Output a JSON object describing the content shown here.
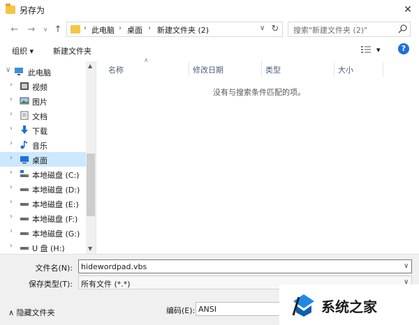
{
  "window": {
    "title": "另存为",
    "close_label": "✕"
  },
  "nav": {
    "back": "←",
    "forward": "→",
    "recent": "∨",
    "up": "↑",
    "breadcrumbs": [
      "此电脑",
      "桌面",
      "新建文件夹 (2)"
    ],
    "breadcrumb_sep": "›",
    "dropdown": "∨",
    "refresh": "↻"
  },
  "search": {
    "placeholder": "搜索\"新建文件夹 (2)\""
  },
  "toolbar": {
    "organize": "组织 ▾",
    "new_folder": "新建文件夹",
    "view_dd": "▾",
    "help": "?"
  },
  "sidebar": {
    "items": [
      {
        "label": "此电脑",
        "icon": "computer-icon",
        "expanded": true
      },
      {
        "label": "视频",
        "icon": "video-folder-icon"
      },
      {
        "label": "图片",
        "icon": "pictures-folder-icon"
      },
      {
        "label": "文档",
        "icon": "documents-folder-icon"
      },
      {
        "label": "下载",
        "icon": "download-icon"
      },
      {
        "label": "音乐",
        "icon": "music-icon"
      },
      {
        "label": "桌面",
        "icon": "desktop-icon",
        "selected": true
      },
      {
        "label": "本地磁盘 (C:)",
        "icon": "system-drive-icon"
      },
      {
        "label": "本地磁盘 (D:)",
        "icon": "drive-icon"
      },
      {
        "label": "本地磁盘 (E:)",
        "icon": "drive-icon"
      },
      {
        "label": "本地磁盘 (F:)",
        "icon": "drive-icon"
      },
      {
        "label": "本地磁盘 (G:)",
        "icon": "drive-icon"
      },
      {
        "label": "U 盘 (H:)",
        "icon": "usb-drive-icon"
      }
    ]
  },
  "file_list": {
    "columns": [
      "名称",
      "修改日期",
      "类型",
      "大小"
    ],
    "empty_message": "没有与搜索条件匹配的项。"
  },
  "form": {
    "filename_label": "文件名(N):",
    "filename_value": "hidewordpad.vbs",
    "filetype_label": "保存类型(T):",
    "filetype_value": "所有文件 (*.*)",
    "dd": "∨"
  },
  "footer": {
    "hide_folders": "隐藏文件夹",
    "hide_chevron": "∧",
    "encoding_label": "编码(E):",
    "encoding_value": "ANSI"
  },
  "watermark": {
    "text": "系统之家"
  },
  "colors": {
    "selection": "#cce8ff",
    "accent": "#1e6fd9",
    "folder": "#f6c445"
  }
}
